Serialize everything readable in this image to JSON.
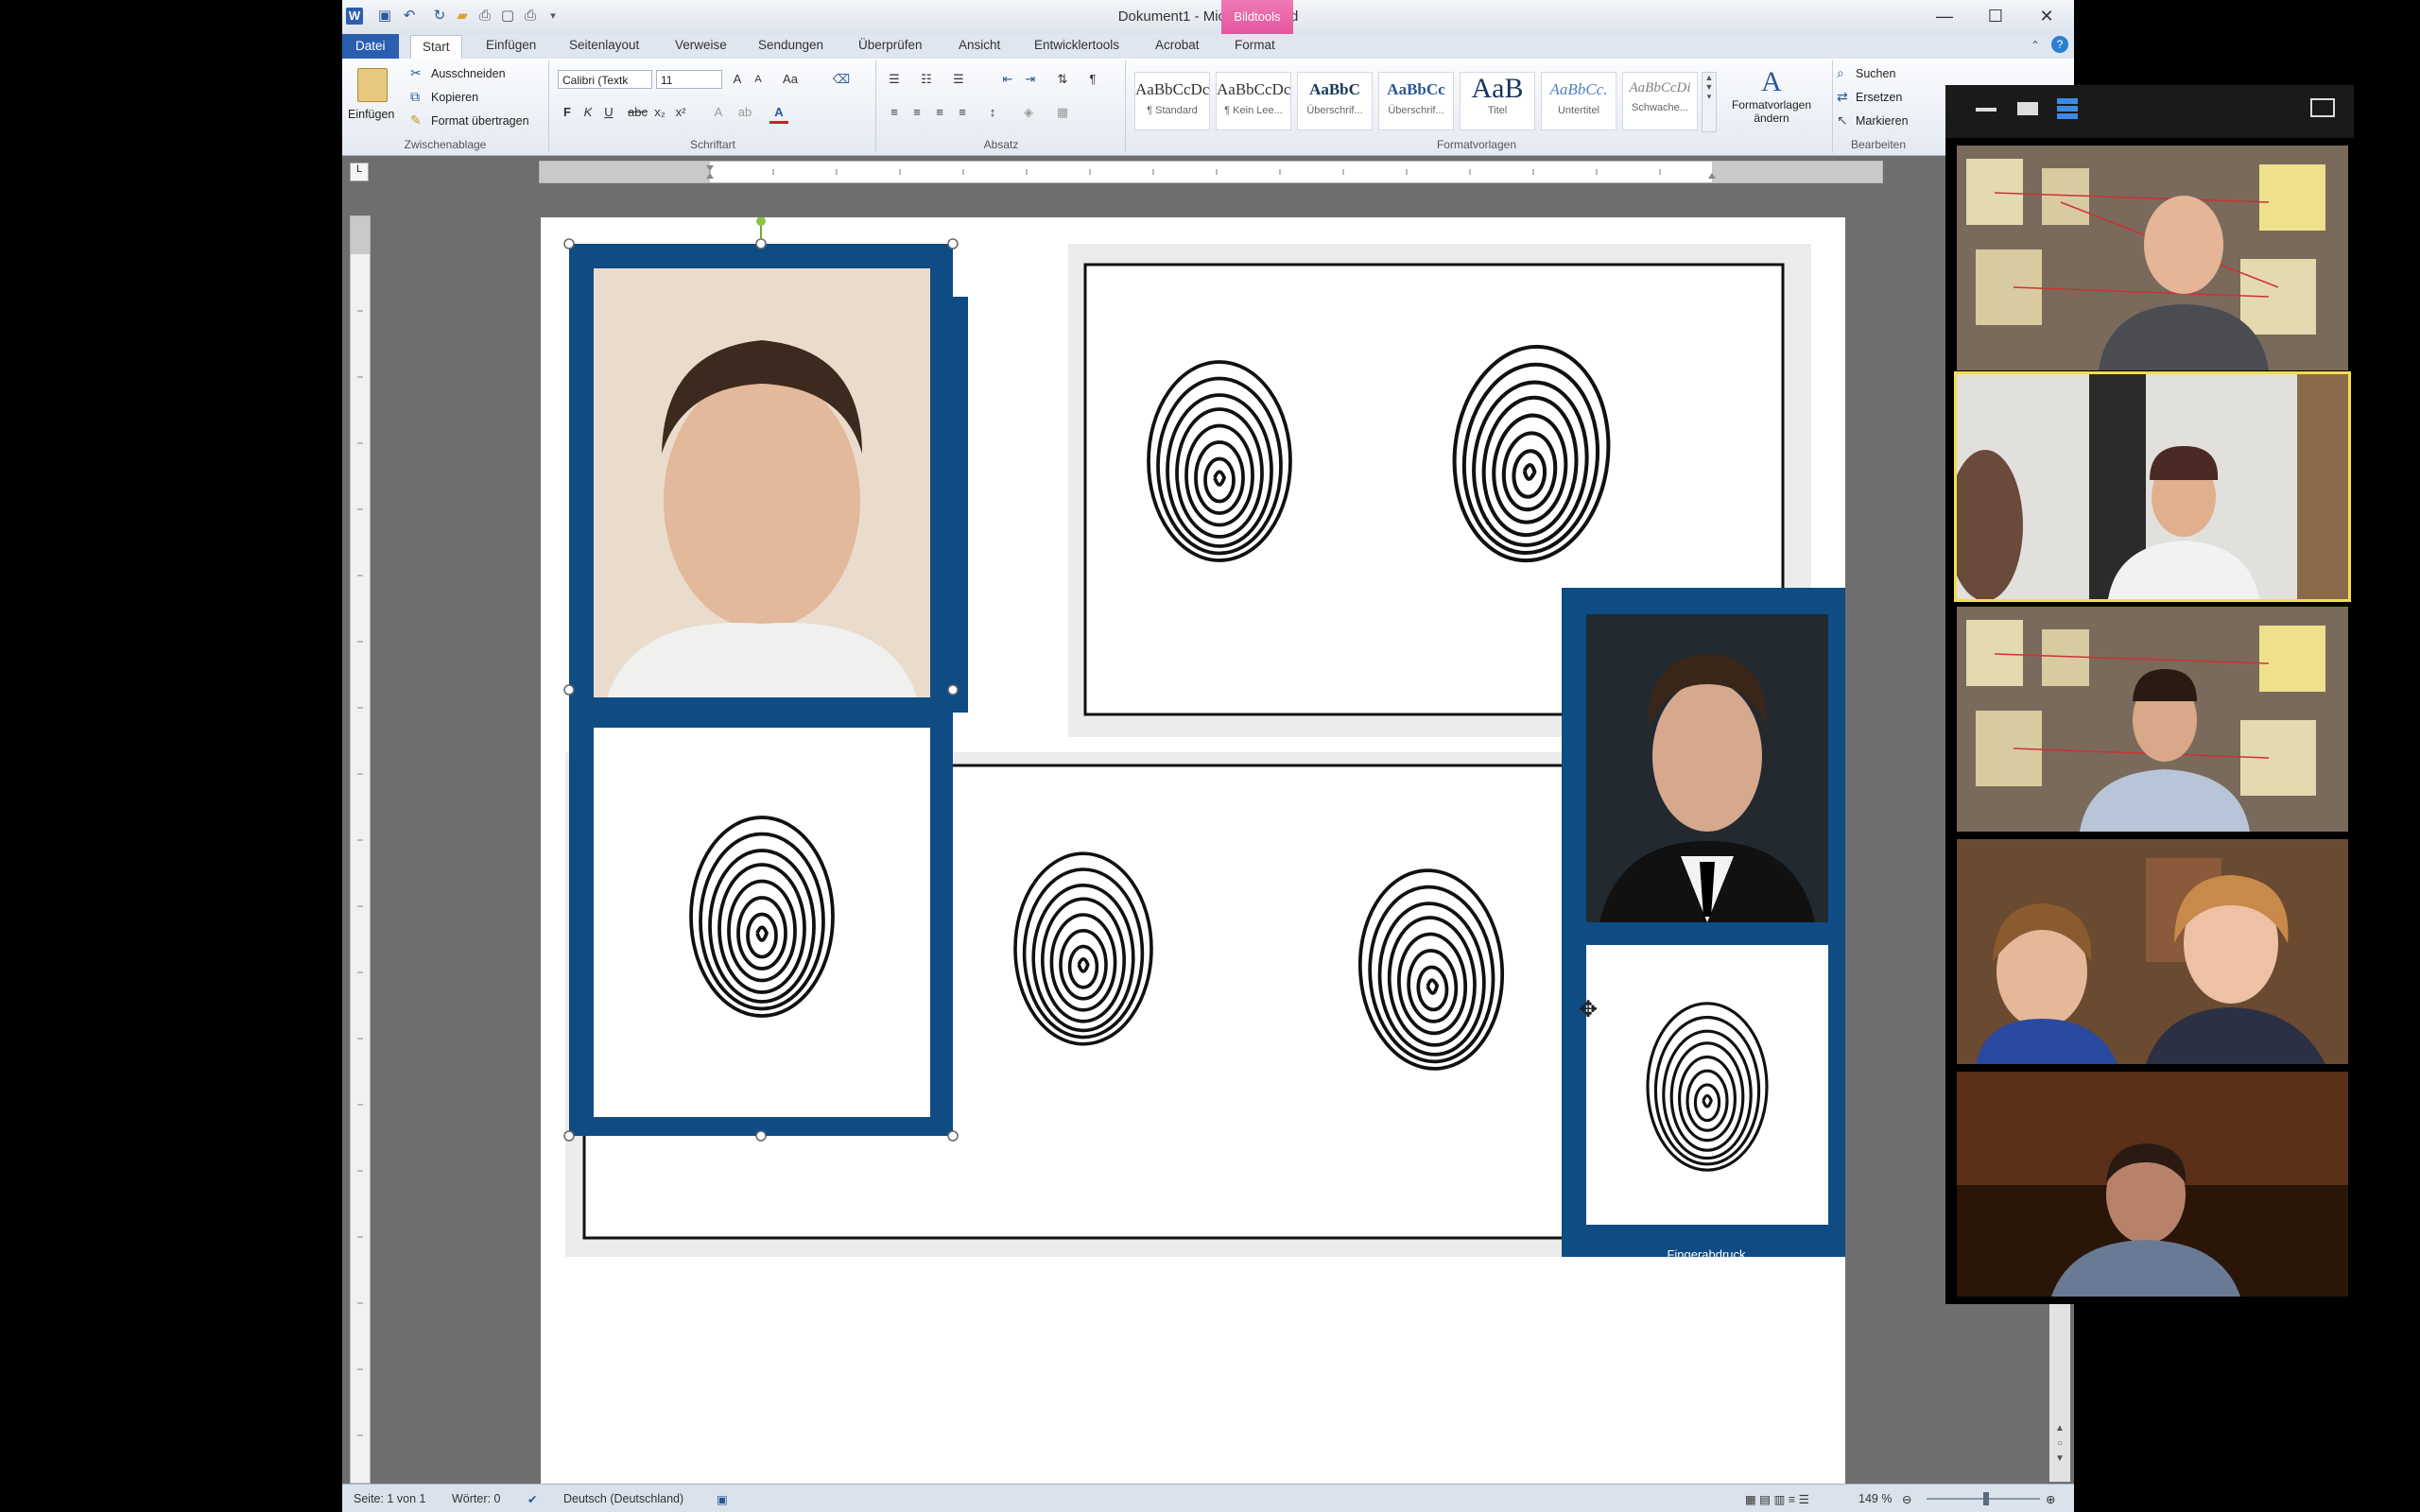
{
  "titlebar": {
    "title": "Dokument1 - Microsoft Word",
    "context_tab": "Bildtools"
  },
  "tabs": [
    "Datei",
    "Start",
    "Einfügen",
    "Seitenlayout",
    "Verweise",
    "Sendungen",
    "Überprüfen",
    "Ansicht",
    "Entwicklertools",
    "Acrobat",
    "Format"
  ],
  "ribbon": {
    "clipboard": {
      "paste": "Einfügen",
      "cut": "Ausschneiden",
      "copy": "Kopieren",
      "format_painter": "Format übertragen",
      "label": "Zwischenablage"
    },
    "font": {
      "font_name": "Calibri (Textk",
      "font_size": "11",
      "label": "Schriftart",
      "bold": "F",
      "italic": "K",
      "underline": "U"
    },
    "paragraph": {
      "label": "Absatz"
    },
    "styles": {
      "label": "Formatvorlagen",
      "items": [
        {
          "preview": "AaBbCcDc",
          "name": "¶ Standard"
        },
        {
          "preview": "AaBbCcDc",
          "name": "¶ Kein Lee..."
        },
        {
          "preview": "AaBbC",
          "name": "Überschrif..."
        },
        {
          "preview": "AaBbCc",
          "name": "Überschrif..."
        },
        {
          "preview": "AaB",
          "name": "Titel"
        },
        {
          "preview": "AaBbCc.",
          "name": "Untertitel"
        },
        {
          "preview": "AaBbCcDi",
          "name": "Schwache..."
        }
      ],
      "change_styles": "Formatvorlagen ändern"
    },
    "editing": {
      "find": "Suchen",
      "replace": "Ersetzen",
      "select": "Markieren",
      "label": "Bearbeiten"
    }
  },
  "document": {
    "caption": "Fingerabdruck"
  },
  "statusbar": {
    "page": "Seite: 1 von 1",
    "words": "Wörter: 0",
    "language": "Deutsch (Deutschland)",
    "zoom": "149 %"
  },
  "colors": {
    "frame_blue": "#0f4c84",
    "word_blue": "#2a5fb0",
    "zoom_active": "#f3dd4e"
  }
}
